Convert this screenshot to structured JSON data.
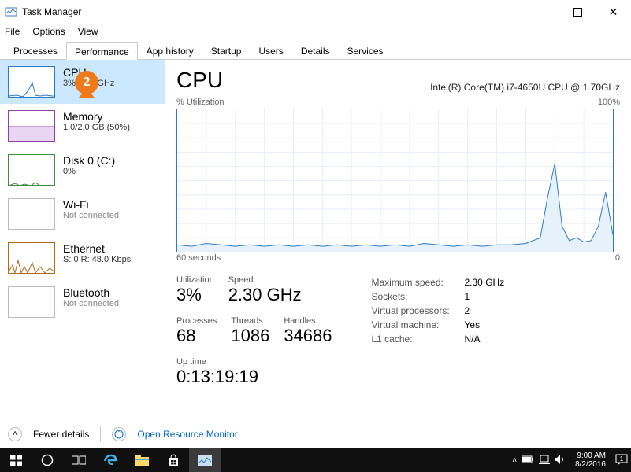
{
  "window": {
    "title": "Task Manager"
  },
  "menu": {
    "file": "File",
    "options": "Options",
    "view": "View"
  },
  "tabs": {
    "processes": "Processes",
    "performance": "Performance",
    "app_history": "App history",
    "startup": "Startup",
    "users": "Users",
    "details": "Details",
    "services": "Services"
  },
  "sidebar": {
    "cpu": {
      "title": "CPU",
      "sub": "3% 1.50 GHz"
    },
    "memory": {
      "title": "Memory",
      "sub": "1.0/2.0 GB (50%)"
    },
    "disk": {
      "title": "Disk 0 (C:)",
      "sub": "0%"
    },
    "wifi": {
      "title": "Wi-Fi",
      "sub": "Not connected"
    },
    "ethernet": {
      "title": "Ethernet",
      "sub": "S: 0 R: 48.0 Kbps"
    },
    "bluetooth": {
      "title": "Bluetooth",
      "sub": "Not connected"
    }
  },
  "detail": {
    "title": "CPU",
    "processor": "Intel(R) Core(TM) i7-4650U CPU @ 1.70GHz",
    "util_axis_left": "% Utilization",
    "util_axis_right": "100%",
    "time_axis_left": "60 seconds",
    "time_axis_right": "0"
  },
  "stats": {
    "utilization_label": "Utilization",
    "utilization": "3%",
    "speed_label": "Speed",
    "speed": "2.30 GHz",
    "processes_label": "Processes",
    "processes": "68",
    "threads_label": "Threads",
    "threads": "1086",
    "handles_label": "Handles",
    "handles": "34686",
    "uptime_label": "Up time",
    "uptime": "0:13:19:19"
  },
  "info": {
    "max_speed_k": "Maximum speed:",
    "max_speed_v": "2.30 GHz",
    "sockets_k": "Sockets:",
    "sockets_v": "1",
    "vproc_k": "Virtual processors:",
    "vproc_v": "2",
    "vmach_k": "Virtual machine:",
    "vmach_v": "Yes",
    "l1_k": "L1 cache:",
    "l1_v": "N/A"
  },
  "footer": {
    "fewer": "Fewer details",
    "resmon": "Open Resource Monitor"
  },
  "tray": {
    "time": "9:00 AM",
    "date": "8/2/2016"
  },
  "badge": {
    "number": "2"
  },
  "chart_data": {
    "type": "line",
    "title": "CPU % Utilization",
    "xlabel": "seconds ago",
    "ylabel": "% Utilization",
    "xlim": [
      60,
      0
    ],
    "ylim": [
      0,
      100
    ],
    "x": [
      60,
      58,
      56,
      54,
      52,
      50,
      48,
      46,
      44,
      42,
      40,
      38,
      36,
      34,
      32,
      30,
      28,
      26,
      24,
      22,
      20,
      18,
      16,
      14,
      12,
      10,
      9,
      8,
      7,
      6,
      5,
      4,
      3,
      2,
      1,
      0
    ],
    "values": [
      5,
      4,
      6,
      5,
      4,
      5,
      4,
      5,
      4,
      5,
      4,
      5,
      4,
      5,
      4,
      5,
      4,
      6,
      5,
      4,
      5,
      4,
      5,
      5,
      6,
      10,
      38,
      62,
      18,
      8,
      10,
      7,
      8,
      18,
      42,
      12
    ]
  }
}
